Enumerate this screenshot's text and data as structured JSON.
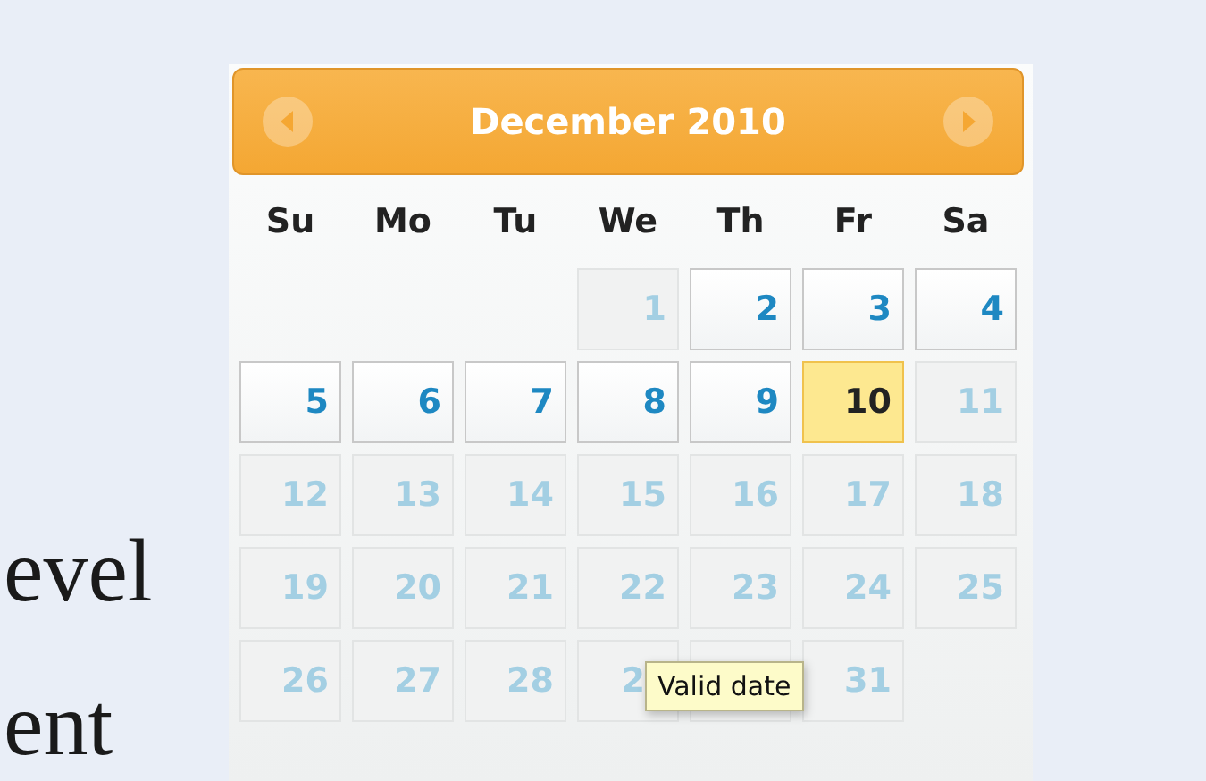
{
  "background_text": [
    "evel",
    "ent"
  ],
  "calendar": {
    "title": "December 2010",
    "weekdays": [
      "Su",
      "Mo",
      "Tu",
      "We",
      "Th",
      "Fr",
      "Sa"
    ],
    "weeks": [
      {
        "days": [
          {
            "label": "1",
            "disabled": true,
            "selected": false
          },
          {
            "label": "2",
            "disabled": false,
            "selected": false
          },
          {
            "label": "3",
            "disabled": false,
            "selected": false
          },
          {
            "label": "4",
            "disabled": false,
            "selected": false
          }
        ]
      },
      {
        "days": [
          {
            "label": "5",
            "disabled": false,
            "selected": false
          },
          {
            "label": "6",
            "disabled": false,
            "selected": false
          },
          {
            "label": "7",
            "disabled": false,
            "selected": false
          },
          {
            "label": "8",
            "disabled": false,
            "selected": false
          },
          {
            "label": "9",
            "disabled": false,
            "selected": false
          },
          {
            "label": "10",
            "disabled": false,
            "selected": true
          },
          {
            "label": "11",
            "disabled": true,
            "selected": false
          }
        ]
      },
      {
        "days": [
          {
            "label": "12",
            "disabled": true,
            "selected": false
          },
          {
            "label": "13",
            "disabled": true,
            "selected": false
          },
          {
            "label": "14",
            "disabled": true,
            "selected": false
          },
          {
            "label": "15",
            "disabled": true,
            "selected": false
          },
          {
            "label": "16",
            "disabled": true,
            "selected": false
          },
          {
            "label": "17",
            "disabled": true,
            "selected": false
          },
          {
            "label": "18",
            "disabled": true,
            "selected": false
          }
        ]
      },
      {
        "days": [
          {
            "label": "19",
            "disabled": true,
            "selected": false
          },
          {
            "label": "20",
            "disabled": true,
            "selected": false
          },
          {
            "label": "21",
            "disabled": true,
            "selected": false
          },
          {
            "label": "22",
            "disabled": true,
            "selected": false
          },
          {
            "label": "23",
            "disabled": true,
            "selected": false
          },
          {
            "label": "24",
            "disabled": true,
            "selected": false
          },
          {
            "label": "25",
            "disabled": true,
            "selected": false
          }
        ]
      },
      {
        "days": [
          {
            "label": "26",
            "disabled": true,
            "selected": false
          },
          {
            "label": "27",
            "disabled": true,
            "selected": false
          },
          {
            "label": "28",
            "disabled": true,
            "selected": false
          },
          {
            "label": "2",
            "disabled": true,
            "selected": false,
            "covered": true
          },
          {
            "disabled": true,
            "selected": false
          },
          {
            "label": "31",
            "disabled": true,
            "selected": false
          }
        ]
      }
    ],
    "tooltip": "Valid date"
  }
}
